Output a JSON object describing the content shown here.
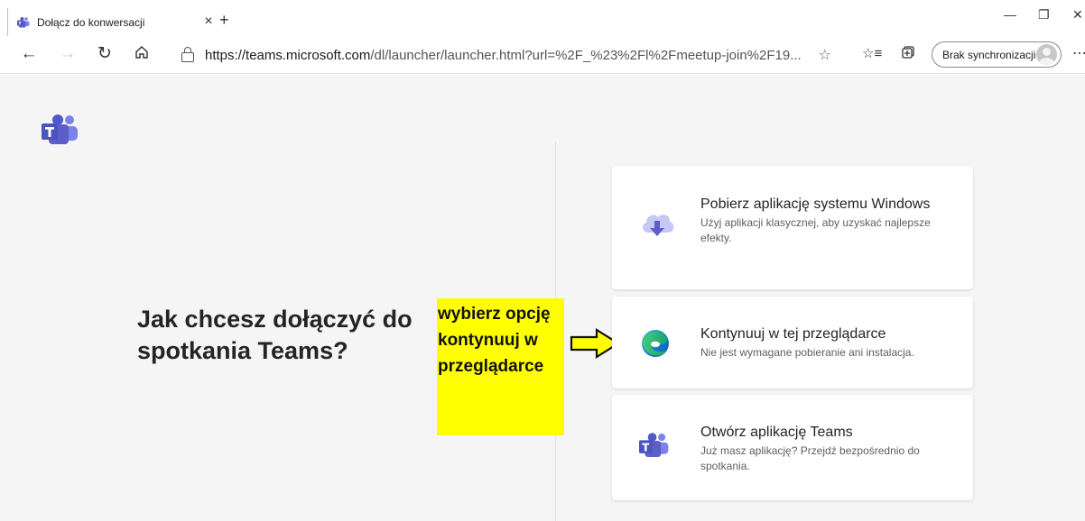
{
  "browser": {
    "tab_title": "Dołącz do konwersacji",
    "tab_close": "×",
    "new_tab": "+",
    "url_host": "https://teams.microsoft.com",
    "url_path": "/dl/launcher/launcher.html?url=%2F_%23%2Fl%2Fmeetup-join%2F19...",
    "sync_label": "Brak synchronizacji"
  },
  "page": {
    "heading": "Jak chcesz dołączyć do spotkania Teams?",
    "callout": "wybierz opcję kontynuuj w przeglądarce",
    "cards": [
      {
        "title": "Pobierz aplikację systemu Windows",
        "description": "Użyj aplikacji klasycznej, aby uzyskać najlepsze efekty.",
        "icon": "cloud-download-icon"
      },
      {
        "title": "Kontynuuj w tej przeglądarce",
        "description": "Nie jest wymagane pobieranie ani instalacja.",
        "icon": "edge-icon"
      },
      {
        "title": "Otwórz aplikację Teams",
        "description": "Już masz aplikację? Przejdź bezpośrednio do spotkania.",
        "icon": "teams-icon"
      }
    ]
  },
  "colors": {
    "teams_purple": "#5b5fc7",
    "callout_yellow": "#ffff00"
  }
}
